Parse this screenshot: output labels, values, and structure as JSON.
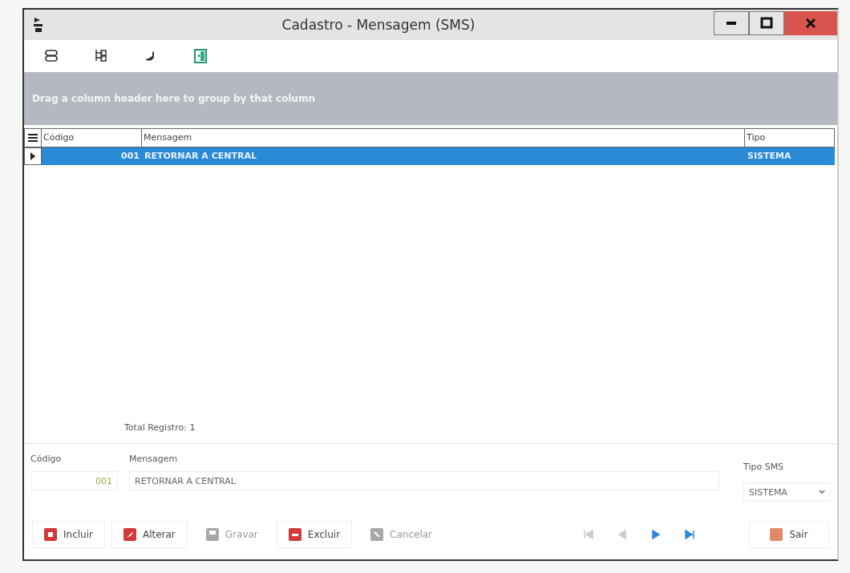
{
  "window": {
    "title": "Cadastro - Mensagem (SMS)"
  },
  "group_panel": {
    "hint": "Drag a column header here to group by that column"
  },
  "grid": {
    "columns": [
      "Código",
      "Mensagem",
      "Tipo"
    ],
    "rows": [
      {
        "cells": [
          "001",
          "RETORNAR A CENTRAL",
          "SISTEMA"
        ],
        "selected": true
      }
    ],
    "footer": "Total Registro: 1"
  },
  "form": {
    "codigo": {
      "label": "Código",
      "value": "001"
    },
    "mensagem": {
      "label": "Mensagem",
      "value": "RETORNAR A CENTRAL"
    },
    "tipo_sms": {
      "label": "Tipo SMS",
      "value": "SISTEMA"
    }
  },
  "buttons": [
    {
      "label": "Incluir",
      "kind": "add",
      "disabled": false
    },
    {
      "label": "Alterar",
      "kind": "edit",
      "disabled": false
    },
    {
      "label": "Gravar",
      "kind": "save",
      "disabled": true
    },
    {
      "label": "Excluir",
      "kind": "delete",
      "disabled": false
    },
    {
      "label": "Cancelar",
      "kind": "cancel",
      "disabled": true
    }
  ],
  "navigator": [
    {
      "kind": "first",
      "disabled": true
    },
    {
      "kind": "prev",
      "disabled": true
    },
    {
      "kind": "next",
      "disabled": false
    },
    {
      "kind": "last",
      "disabled": false
    }
  ],
  "exit_button": {
    "label": "Sair"
  }
}
